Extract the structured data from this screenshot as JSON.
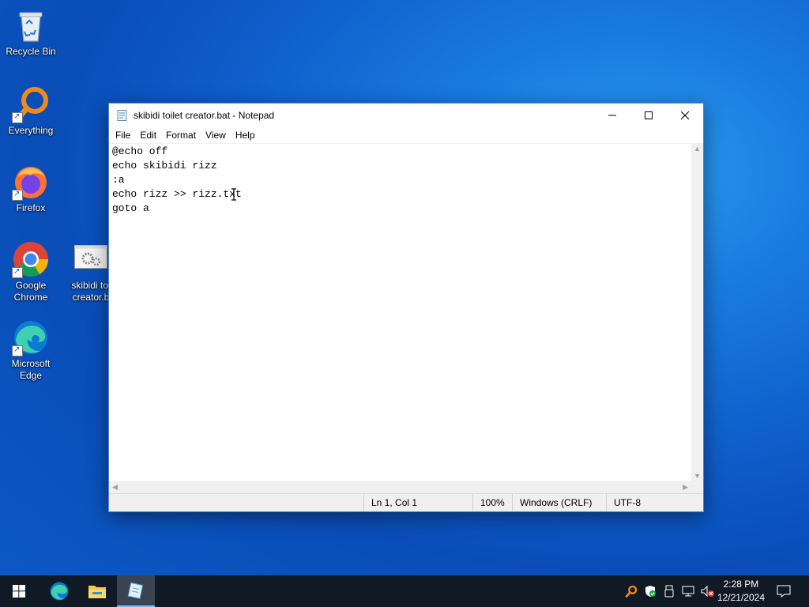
{
  "desktop": {
    "icons": [
      {
        "label": "Recycle Bin"
      },
      {
        "label": "Everything"
      },
      {
        "label": "Firefox"
      },
      {
        "label_line1": "Google",
        "label_line2": "Chrome"
      },
      {
        "label_line1": "skibidi toi",
        "label_line2": "creator.b"
      },
      {
        "label_line1": "Microsoft",
        "label_line2": "Edge"
      }
    ]
  },
  "window": {
    "title": "skibidi toilet creator.bat - Notepad",
    "menu": [
      "File",
      "Edit",
      "Format",
      "View",
      "Help"
    ],
    "content": "@echo off\necho skibidi rizz\n:a\necho rizz >> rizz.txt\ngoto a",
    "status": {
      "position": "Ln 1, Col 1",
      "zoom": "100%",
      "line_endings": "Windows (CRLF)",
      "encoding": "UTF-8"
    }
  },
  "taskbar": {
    "time": "2:28 PM",
    "date": "12/21/2024"
  },
  "colors": {
    "accent": "#0078d7",
    "taskbar": "#101a24"
  }
}
